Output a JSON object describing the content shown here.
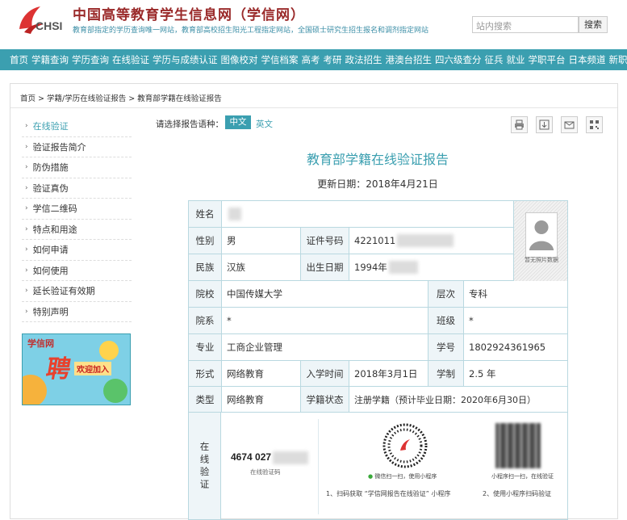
{
  "header": {
    "site_title": "中国高等教育学生信息网（学信网）",
    "logo_text": "CHSI",
    "subtitle": "教育部指定的学历查询唯一网站，教育部高校招生阳光工程指定网站，全国硕士研究生招生报名和调剂指定网站",
    "search_placeholder": "站内搜索",
    "search_button": "搜索"
  },
  "nav": [
    "首页",
    "学籍查询",
    "学历查询",
    "在线验证",
    "学历与成绩认证",
    "图像校对",
    "学信档案",
    "高考",
    "考研",
    "政法招生",
    "港澳台招生",
    "四六级查分",
    "征兵",
    "就业",
    "学职平台",
    "日本频道",
    "新职业"
  ],
  "breadcrumb": "首页 > 学籍/学历在线验证报告 > 教育部学籍在线验证报告",
  "sidebar": [
    "在线验证",
    "验证报告简介",
    "防伪措施",
    "验证真伪",
    "学信二维码",
    "特点和用途",
    "如何申请",
    "如何使用",
    "延长验证有效期",
    "特别声明"
  ],
  "ad": {
    "brand": "学信网",
    "big": "聘",
    "small": "欢迎加入"
  },
  "lang": {
    "label": "请选择报告语种：",
    "cn": "中文",
    "en": "英文"
  },
  "report": {
    "title": "教育部学籍在线验证报告",
    "date": "更新日期：2018年4月21日",
    "name_label": "姓名",
    "name_value": "",
    "gender_label": "性别",
    "gender_value": "男",
    "id_label": "证件号码",
    "id_value": "4221011",
    "ethnic_label": "民族",
    "ethnic_value": "汉族",
    "birth_label": "出生日期",
    "birth_value": "1994年",
    "school_label": "院校",
    "school_value": "中国传媒大学",
    "level_label": "层次",
    "level_value": "专科",
    "dept_label": "院系",
    "dept_value": "*",
    "class_label": "班级",
    "class_value": "*",
    "major_label": "专业",
    "major_value": "工商企业管理",
    "stuno_label": "学号",
    "stuno_value": "1802924361965",
    "form_label": "形式",
    "form_value": "网络教育",
    "entry_label": "入学时间",
    "entry_value": "2018年3月1日",
    "length_label": "学制",
    "length_value": "2.5 年",
    "type_label": "类型",
    "type_value": "网络教育",
    "status_label": "学籍状态",
    "status_value": "注册学籍（预计毕业日期：2020年6月30日）",
    "photo_caption": "暂无照片数据",
    "verify_label": "在线验证",
    "verify_code": "4674 027",
    "verify_code_sub": "在线验证码",
    "qr1_caption": "微信扫一扫，使用小程序",
    "qr2_caption": "小程序扫一扫，在线验证",
    "step1": "1、扫码获取 “学信网报告在线验证” 小程序",
    "step2": "2、使用小程序扫码验证"
  }
}
